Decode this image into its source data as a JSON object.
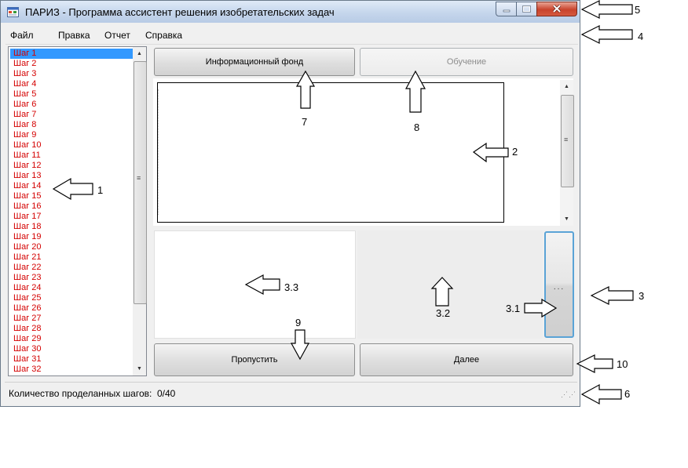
{
  "window": {
    "title": "ПАРИЗ - Программа ассистент решения изобретательских задач"
  },
  "menu": [
    "Файл",
    "Правка",
    "Отчет",
    "Справка"
  ],
  "steps": [
    "Шаг 1",
    "Шаг 2",
    "Шаг 3",
    "Шаг 4",
    "Шаг 5",
    "Шаг 6",
    "Шаг 7",
    "Шаг 8",
    "Шаг 9",
    "Шаг 10",
    "Шаг 11",
    "Шаг 12",
    "Шаг 13",
    "Шаг 14",
    "Шаг 15",
    "Шаг 16",
    "Шаг 17",
    "Шаг 18",
    "Шаг 19",
    "Шаг 20",
    "Шаг 21",
    "Шаг 22",
    "Шаг 23",
    "Шаг 24",
    "Шаг 25",
    "Шаг 26",
    "Шаг 27",
    "Шаг 28",
    "Шаг 29",
    "Шаг 30",
    "Шаг 31",
    "Шаг 32"
  ],
  "selected_step": 0,
  "buttons": {
    "info_fund": "Информационный фонд",
    "training": "Обучение",
    "skip": "Пропустить",
    "next": "Далее",
    "ellipsis": "..."
  },
  "status": {
    "label": "Количество проделанных шагов:",
    "value": "0/40"
  },
  "annotations": [
    "1",
    "2",
    "3",
    "3.1",
    "3.2",
    "3.3",
    "4",
    "5",
    "6",
    "7",
    "8",
    "9",
    "10"
  ],
  "colors": {
    "step_text": "#d40000",
    "selection": "#3399ff",
    "focus_border": "#5aa3d6"
  }
}
